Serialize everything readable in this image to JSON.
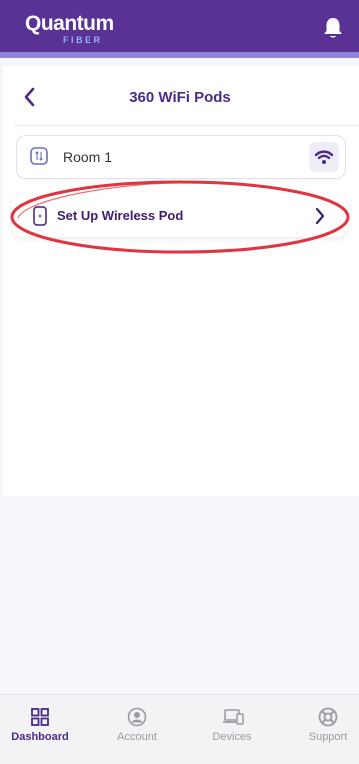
{
  "header": {
    "logo_main": "Quantum",
    "logo_sub": "FIBER",
    "bell_icon": "bell-icon"
  },
  "page": {
    "title": "360 WiFi Pods",
    "back_icon": "chevron-left-icon"
  },
  "room": {
    "label": "Room 1",
    "icon": "router-icon",
    "wifi_icon": "wifi-icon"
  },
  "setup": {
    "label": "Set Up Wireless Pod",
    "icon": "pod-icon",
    "chevron_icon": "chevron-right-icon"
  },
  "colors": {
    "brand": "#5a3194",
    "accent_strip": "#8f84d8",
    "annotation": "#e0343f"
  },
  "bottom_nav": [
    {
      "label": "Dashboard",
      "icon": "grid-icon",
      "active": true
    },
    {
      "label": "Account",
      "icon": "user-circle-icon",
      "active": false
    },
    {
      "label": "Devices",
      "icon": "devices-icon",
      "active": false
    },
    {
      "label": "Support",
      "icon": "lifebuoy-icon",
      "active": false
    }
  ]
}
